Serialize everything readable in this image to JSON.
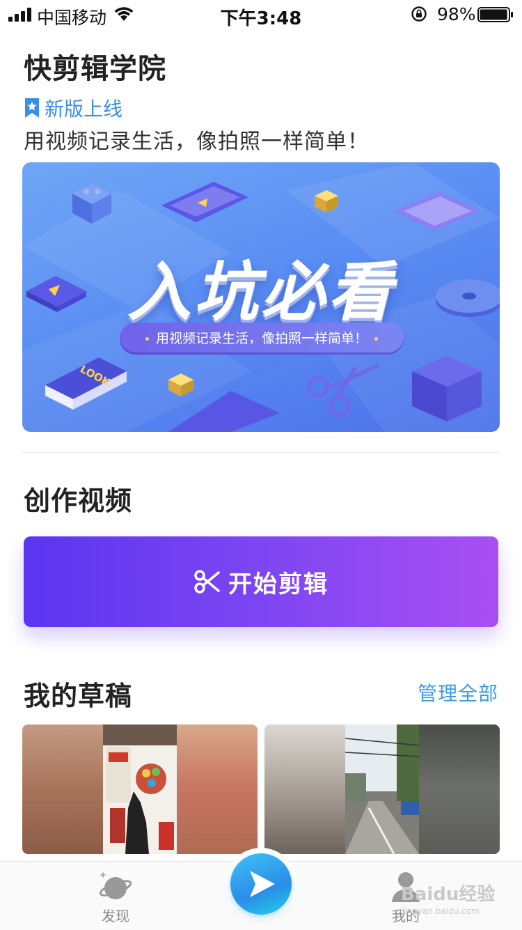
{
  "status_bar": {
    "carrier": "中国移动",
    "time": "下午3:48",
    "battery_percent": "98%",
    "battery_level": 0.98
  },
  "header": {
    "title": "快剪辑学院",
    "badge": "新版上线",
    "tagline": "用视频记录生活，像拍照一样简单！"
  },
  "banner": {
    "headline": "入坑必看",
    "subtitle": "用视频记录生活，像拍照一样简单！",
    "book_text": "LOOK"
  },
  "create": {
    "section_title": "创作视频",
    "start_button": "开始剪辑"
  },
  "drafts": {
    "section_title": "我的草稿",
    "manage_link": "管理全部"
  },
  "tabbar": {
    "discover": "发现",
    "mine": "我的"
  },
  "watermark": {
    "brand": "Baidu经验",
    "url": "jingyan.baidu.com"
  },
  "colors": {
    "accent_blue": "#3a9be8",
    "button_gradient_start": "#5b35f0",
    "button_gradient_end": "#a84ff2",
    "banner_blue": "#5a8ef3"
  },
  "icons": {
    "badge": "bookmark-star-icon",
    "start_button": "scissors-icon",
    "center_tab": "play-icon",
    "discover_tab": "planet-icon",
    "mine_tab": "person-icon"
  }
}
